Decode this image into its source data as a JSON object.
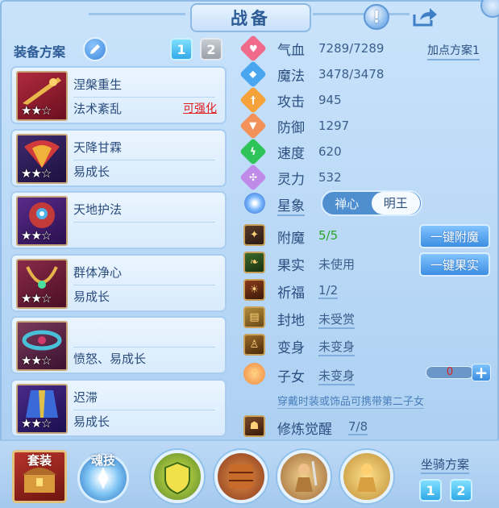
{
  "header": {
    "title": "战备"
  },
  "equip_scheme": {
    "label": "装备方案",
    "tabs": [
      "1",
      "2"
    ],
    "active_tab": "1"
  },
  "equipment": [
    {
      "name": "涅槃重生",
      "effect": "法术紊乱",
      "upgrade": "可强化",
      "stars": "★★☆"
    },
    {
      "name": "天降甘霖",
      "effect": "易成长",
      "upgrade": "",
      "stars": "★★☆"
    },
    {
      "name": "天地护法",
      "effect": "",
      "upgrade": "",
      "stars": "★★☆"
    },
    {
      "name": "群体净心",
      "effect": "易成长",
      "upgrade": "",
      "stars": "★★☆"
    },
    {
      "name": "",
      "effect": "愤怒、易成长",
      "upgrade": "",
      "stars": "★★☆"
    },
    {
      "name": "迟滞",
      "effect": "易成长",
      "upgrade": "",
      "stars": "★★☆"
    }
  ],
  "stats": [
    {
      "label": "气血",
      "value": "7289/7289",
      "icon": "heart-icon",
      "color": "#f06a8c"
    },
    {
      "label": "魔法",
      "value": "3478/3478",
      "icon": "mana-icon",
      "color": "#4aa6ef"
    },
    {
      "label": "攻击",
      "value": "945",
      "icon": "sword-icon",
      "color": "#f5a23a"
    },
    {
      "label": "防御",
      "value": "1297",
      "icon": "shield-icon",
      "color": "#f2925a"
    },
    {
      "label": "速度",
      "value": "620",
      "icon": "speed-icon",
      "color": "#2fc45a"
    },
    {
      "label": "灵力",
      "value": "532",
      "icon": "spirit-icon",
      "color": "#c08ae8"
    }
  ],
  "add_point_scheme": "加点方案1",
  "star_sign": {
    "label": "星象",
    "options": [
      "禅心",
      "明王"
    ],
    "selected": "明王"
  },
  "features": [
    {
      "label": "附魔",
      "value": "5/5",
      "icon": "enchant-icon"
    },
    {
      "label": "果实",
      "value": "未使用",
      "icon": "fruit-icon"
    },
    {
      "label": "祈福",
      "value": "1/2",
      "icon": "blessing-icon"
    },
    {
      "label": "封地",
      "value": "未受赏",
      "icon": "fief-icon"
    },
    {
      "label": "变身",
      "value": "未变身",
      "icon": "transform-icon"
    },
    {
      "label": "子女",
      "value": "未变身",
      "icon": "child-icon"
    }
  ],
  "buttons": {
    "one_key_enchant": "一键附魔",
    "one_key_fruit": "一键果实"
  },
  "child": {
    "count": "0",
    "plus": "+",
    "hint": "穿戴时装或饰品可携带第二子女"
  },
  "cultivation": {
    "label": "修炼觉醒",
    "value": "7/8",
    "icon": "cultivation-icon"
  },
  "bottom": {
    "suit_label": "套装",
    "soul_label": "魂技",
    "mount_label": "坐骑方案",
    "mount_tabs": [
      "1",
      "2"
    ]
  },
  "colors": {
    "accent": "#3c8ee3",
    "warning": "#e02020",
    "green": "#2aa52a"
  }
}
